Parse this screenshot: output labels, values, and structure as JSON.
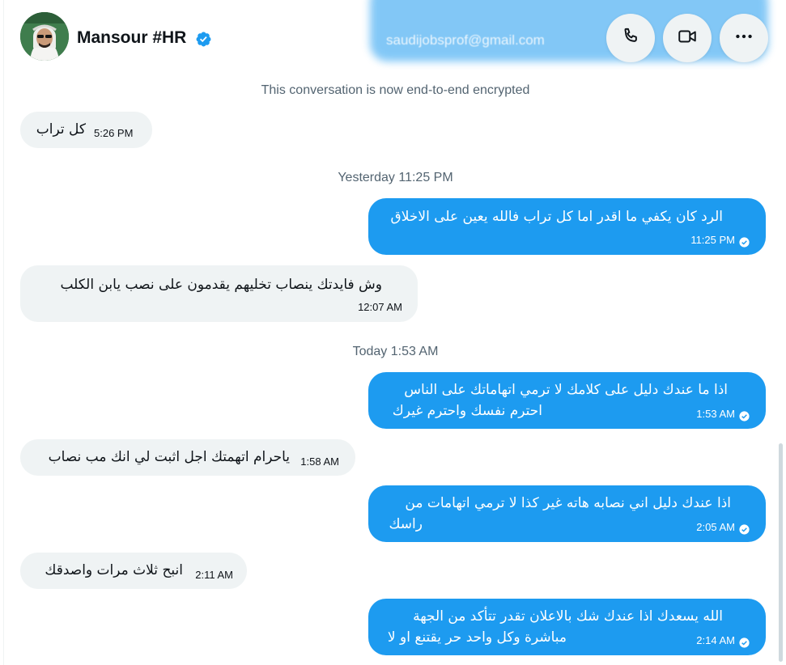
{
  "header": {
    "name": "Mansour #HR",
    "verified": true,
    "ghost_text": "saudijobsprof@gmail.com"
  },
  "encryption_note": "This conversation is now end-to-end encrypted",
  "dividers": [
    "Yesterday 11:25 PM",
    "Today 1:53 AM"
  ],
  "messages": [
    {
      "dir": "in",
      "lines": [
        "كل تراب"
      ],
      "time": "5:26 PM"
    },
    {
      "dir": "out",
      "lines": [
        "الرد كان يكفي ما اقدر اما كل تراب فالله يعين على الاخلاق"
      ],
      "time": "11:25 PM"
    },
    {
      "dir": "in",
      "lines": [
        "وش فايدتك ينصاب تخليهم يقدمون على نصب يابن الكلب"
      ],
      "time": "12:07 AM"
    },
    {
      "dir": "out",
      "lines": [
        "اذا ما عندك دليل على كلامك لا ترمي اتهاماتك على الناس",
        "احترم نفسك واحترم غيرك"
      ],
      "time": "1:53 AM"
    },
    {
      "dir": "in",
      "lines": [
        "ياحرام اتهمتك اجل اثبت لي انك مب نصاب"
      ],
      "time": "1:58 AM"
    },
    {
      "dir": "out",
      "lines": [
        "اذا عندك دليل اني نصابه هاته غير كذا لا ترمي اتهامات من",
        "راسك"
      ],
      "time": "2:05 AM"
    },
    {
      "dir": "in",
      "lines": [
        "انبح ثلاث مرات واصدقك"
      ],
      "time": "2:11 AM"
    },
    {
      "dir": "out",
      "lines": [
        "الله يسعدك اذا عندك شك بالاعلان تقدر تتأكد من الجهة",
        "مباشرة وكل واحد حر يقتنع او لا"
      ],
      "time": "2:14 AM"
    }
  ],
  "colors": {
    "accent": "#1d9bf0",
    "incoming_bubble": "#eff3f4",
    "muted_text": "#536471"
  },
  "icons": {
    "call": "phone-icon",
    "video": "video-camera-icon",
    "more": "more-horizontal-icon",
    "verified": "verified-badge-icon",
    "read": "read-check-icon"
  }
}
